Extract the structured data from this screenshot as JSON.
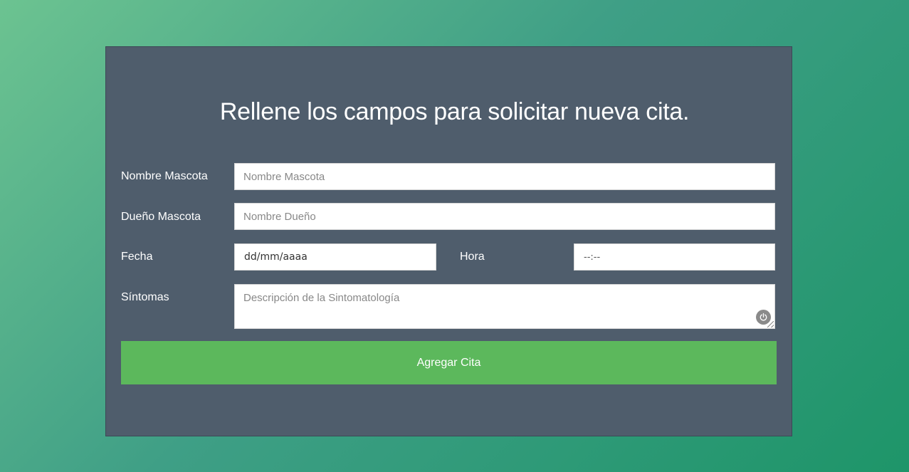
{
  "form": {
    "title": "Rellene los campos para solicitar nueva cita.",
    "pet_name": {
      "label": "Nombre Mascota",
      "placeholder": "Nombre Mascota",
      "value": ""
    },
    "owner_name": {
      "label": "Dueño Mascota",
      "placeholder": "Nombre Dueño",
      "value": ""
    },
    "date": {
      "label": "Fecha",
      "display": "dd/mm/aaaa"
    },
    "time": {
      "label": "Hora",
      "display": "--:--"
    },
    "symptoms": {
      "label": "Síntomas",
      "placeholder": "Descripción de la Sintomatología",
      "value": ""
    },
    "submit_label": "Agregar Cita"
  },
  "colors": {
    "card_background": "#4f5d6c",
    "submit_button": "#5cb85c",
    "text": "#ffffff"
  },
  "icons": {
    "textarea_extension_icon": "power-icon"
  }
}
